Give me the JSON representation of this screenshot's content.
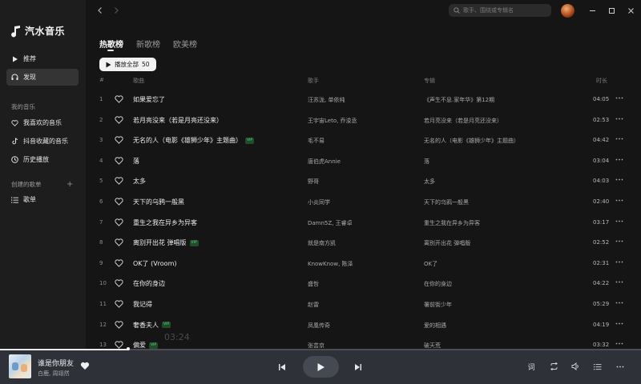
{
  "app": {
    "name": "汽水音乐"
  },
  "sidebar": {
    "nav": [
      {
        "label": "推荐",
        "icon": "play-icon"
      },
      {
        "label": "发现",
        "icon": "headphones-icon",
        "active": true
      }
    ],
    "my_music_title": "我的音乐",
    "my_music": [
      {
        "label": "我喜欢的音乐",
        "icon": "heart-icon"
      },
      {
        "label": "抖音收藏的音乐",
        "icon": "douyin-icon"
      },
      {
        "label": "历史播放",
        "icon": "clock-icon"
      }
    ],
    "created_title": "创建的歌单",
    "created_add": "+",
    "playlists": [
      {
        "label": "歌单",
        "icon": "list-icon"
      }
    ]
  },
  "topbar": {
    "search_placeholder": "歌手、围绕或专辑名"
  },
  "tabs": [
    {
      "label": "热歌榜",
      "active": true
    },
    {
      "label": "新歌榜"
    },
    {
      "label": "欧美榜"
    }
  ],
  "play_all": {
    "label": "播放全部",
    "count": "50"
  },
  "columns": {
    "num": "#",
    "title": "歌曲",
    "artist": "歌手",
    "album": "专辑",
    "duration": "时长"
  },
  "songs": [
    {
      "num": "1",
      "title": "如果爱忘了",
      "vip": false,
      "artist": "汪苏泷, 单依纯",
      "album": "《声生不息.家年华》第12期",
      "duration": "04:05"
    },
    {
      "num": "2",
      "title": "若月亮没来（若是月亮还没来）",
      "vip": false,
      "artist": "王宇宙Leto, 乔浚丞",
      "album": "若月亮没来（若是月亮还没来）",
      "duration": "02:53"
    },
    {
      "num": "3",
      "title": "无名的人（电影《雄狮少年》主题曲）",
      "vip": true,
      "artist": "毛不易",
      "album": "无名的人（电影《雄狮少年》主题曲）",
      "duration": "04:42"
    },
    {
      "num": "4",
      "title": "落",
      "vip": false,
      "artist": "唐伯虎Annie",
      "album": "落",
      "duration": "03:04"
    },
    {
      "num": "5",
      "title": "太多",
      "vip": false,
      "artist": "野哥",
      "album": "太多",
      "duration": "04:03"
    },
    {
      "num": "6",
      "title": "天下的乌鸦一般黑",
      "vip": false,
      "artist": "小炎同学",
      "album": "天下的乌鸦一般黑",
      "duration": "02:40"
    },
    {
      "num": "7",
      "title": "重生之我在异乡为异客",
      "vip": false,
      "artist": "Damn5Z, 王睿卓",
      "album": "重生之我在异乡为异客",
      "duration": "03:17"
    },
    {
      "num": "8",
      "title": "离别开出花 弹唱版",
      "vip": true,
      "artist": "就是南方凯",
      "album": "离别开出花 弹唱版",
      "duration": "02:52"
    },
    {
      "num": "9",
      "title": "OK了 (Vroom)",
      "vip": false,
      "artist": "KnowKnow, 陈泽",
      "album": "OK了",
      "duration": "02:31"
    },
    {
      "num": "10",
      "title": "在你的身边",
      "vip": false,
      "artist": "盛哲",
      "album": "在你的身边",
      "duration": "04:22"
    },
    {
      "num": "11",
      "title": "我记得",
      "vip": false,
      "artist": "赵雷",
      "album": "署前街少年",
      "duration": "05:29"
    },
    {
      "num": "12",
      "title": "奢香夫人",
      "vip": true,
      "artist": "凤凰传奇",
      "album": "爱的相遇",
      "duration": "04:19"
    },
    {
      "num": "13",
      "title": "偏爱",
      "vip": true,
      "artist": "张芸京",
      "album": "破天荒",
      "duration": "03:32"
    }
  ],
  "vip_label": "VIP",
  "ghost_time": "03:24",
  "player": {
    "song": "谁是你朋友",
    "artist": "白鹿, 周翊然",
    "progress": 0.2,
    "lyrics_label": "词"
  },
  "colors": {
    "accent_vip": "#5fd382",
    "player_bg": "#2e3238"
  }
}
